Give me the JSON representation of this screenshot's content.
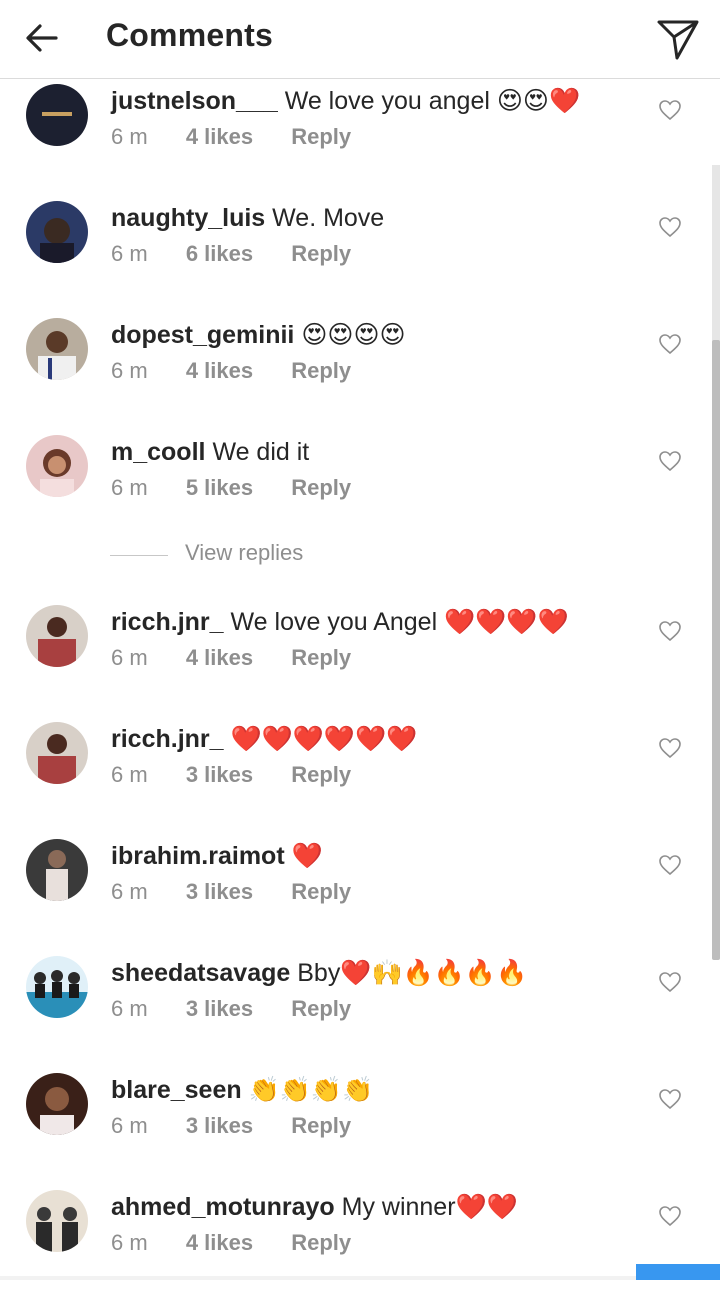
{
  "header": {
    "title": "Comments"
  },
  "view_replies": "View replies",
  "comments": [
    {
      "user": "justnelson___",
      "text": "We love you angel 😍😍❤️",
      "time": "6 m",
      "likes": "4 likes",
      "reply": "Reply",
      "avatar_color": "#1c2030"
    },
    {
      "user": "naughty_luis",
      "text": "We. Move",
      "time": "6 m",
      "likes": "6 likes",
      "reply": "Reply",
      "avatar_color": "#2b3a66"
    },
    {
      "user": "dopest_geminii",
      "text": "😍😍😍😍",
      "time": "6 m",
      "likes": "4 likes",
      "reply": "Reply",
      "avatar_color": "#7a6a5a"
    },
    {
      "user": "m_cooll",
      "text": "We did it",
      "time": "6 m",
      "likes": "5 likes",
      "reply": "Reply",
      "avatar_color": "#d8a0a0"
    },
    {
      "user": "ricch.jnr_",
      "text": "We love you Angel ❤️❤️❤️❤️",
      "time": "6 m",
      "likes": "4 likes",
      "reply": "Reply",
      "avatar_color": "#a84040"
    },
    {
      "user": "ricch.jnr_",
      "text": "❤️❤️❤️❤️❤️❤️",
      "time": "6 m",
      "likes": "3 likes",
      "reply": "Reply",
      "avatar_color": "#a84040"
    },
    {
      "user": "ibrahim.raimot",
      "text": "❤️",
      "time": "6 m",
      "likes": "3 likes",
      "reply": "Reply",
      "avatar_color": "#3a3a3a"
    },
    {
      "user": "sheedatsavage",
      "text": "Bby❤️🙌🔥🔥🔥🔥",
      "time": "6 m",
      "likes": "3 likes",
      "reply": "Reply",
      "avatar_color": "#2a8fb8"
    },
    {
      "user": "blare_seen",
      "text": "👏👏👏👏",
      "time": "6 m",
      "likes": "3 likes",
      "reply": "Reply",
      "avatar_color": "#3a2018"
    },
    {
      "user": "ahmed_motunrayo",
      "text": "My winner❤️❤️",
      "time": "6 m",
      "likes": "4 likes",
      "reply": "Reply",
      "avatar_color": "#8a7a6a"
    }
  ]
}
